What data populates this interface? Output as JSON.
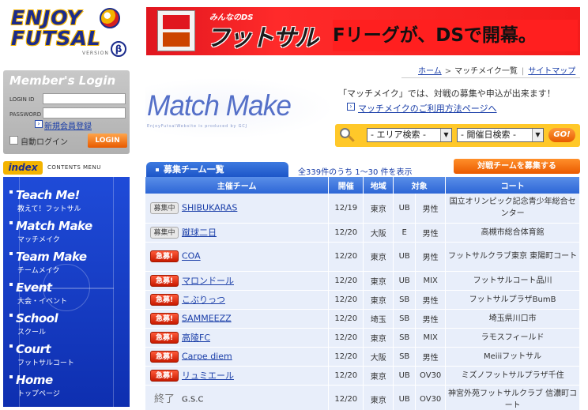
{
  "logo": {
    "line1": "ENJOY",
    "line2": "FUTSAL",
    "version": "VERSION",
    "beta": "β"
  },
  "login": {
    "title": "Member's Login",
    "login_id_label": "LOGIN ID",
    "password_label": "PASSWORD",
    "register_link": "新規会員登録",
    "auto_login_label": "自動ログイン",
    "login_button": "LOGIN"
  },
  "index": {
    "badge": "index",
    "caption": "CONTENTS MENU"
  },
  "nav": [
    {
      "en": "Teach Me!",
      "jp": "教えて！フットサル"
    },
    {
      "en": "Match Make",
      "jp": "マッチメイク"
    },
    {
      "en": "Team Make",
      "jp": "チームメイク"
    },
    {
      "en": "Event",
      "jp": "大会・イベント"
    },
    {
      "en": "School",
      "jp": "スクール"
    },
    {
      "en": "Court",
      "jp": "フットサルコート"
    },
    {
      "en": "Home",
      "jp": "トップページ"
    }
  ],
  "banner": {
    "small": "みんなのDS",
    "big": "フットサル",
    "slogan": "Fリーグが、DSで開幕。"
  },
  "breadcrumb": {
    "home": "ホーム",
    "current": "マッチメイク一覧",
    "sitemap": "サイトマップ"
  },
  "page": {
    "title": "Match Make",
    "subtitle": "EnjoyFutsalWebsite is produced by GCJ",
    "description": "「マッチメイク」では、対戦の募集や申込が出来ます！",
    "guide_link": "マッチメイクのご利用方法ページへ"
  },
  "search": {
    "area_value": "- エリア検索 -",
    "date_value": "- 開催日検索 -",
    "go_label": "GO!"
  },
  "list": {
    "tab_title": "募集チーム一覧",
    "count_text": "全339件のうち 1〜30 件を表示",
    "recruit_button": "対戦チームを募集する",
    "headers": [
      "主催チーム",
      "開催",
      "地域",
      "対象",
      "",
      "コート"
    ],
    "rows": [
      {
        "status": "募集中",
        "status_type": "open",
        "team": "SHIBUKARAS",
        "link": true,
        "date": "12/19",
        "area": "東京",
        "target": "UB",
        "gender": "男性",
        "court": "国立オリンピック記念青少年総合センター"
      },
      {
        "status": "募集中",
        "status_type": "open",
        "team": "蹴球二日",
        "link": true,
        "date": "12/20",
        "area": "大阪",
        "target": "E",
        "gender": "男性",
        "court": "高槻市総合体育館"
      },
      {
        "status": "急募!",
        "status_type": "urgent",
        "team": "COA",
        "link": true,
        "date": "12/20",
        "area": "東京",
        "target": "UB",
        "gender": "男性",
        "court": "フットサルクラブ東京 東陽町コート"
      },
      {
        "status": "急募!",
        "status_type": "urgent",
        "team": "マロンドール",
        "link": true,
        "date": "12/20",
        "area": "東京",
        "target": "UB",
        "gender": "MIX",
        "court": "フットサルコート品川"
      },
      {
        "status": "急募!",
        "status_type": "urgent",
        "team": "こぶりっつ",
        "link": true,
        "date": "12/20",
        "area": "東京",
        "target": "SB",
        "gender": "男性",
        "court": "フットサルプラザBumB"
      },
      {
        "status": "急募!",
        "status_type": "urgent",
        "team": "SAMMEEZZ",
        "link": true,
        "date": "12/20",
        "area": "埼玉",
        "target": "SB",
        "gender": "男性",
        "court": "埼玉県川口市"
      },
      {
        "status": "急募!",
        "status_type": "urgent",
        "team": "高陵FC",
        "link": true,
        "date": "12/20",
        "area": "東京",
        "target": "SB",
        "gender": "MIX",
        "court": "ラモスフィールド"
      },
      {
        "status": "急募!",
        "status_type": "urgent",
        "team": "Carpe diem",
        "link": true,
        "date": "12/20",
        "area": "大阪",
        "target": "SB",
        "gender": "男性",
        "court": "Meiiiフットサル"
      },
      {
        "status": "急募!",
        "status_type": "urgent",
        "team": "リュミエール",
        "link": true,
        "date": "12/20",
        "area": "東京",
        "target": "UB",
        "gender": "OV30",
        "court": "ミズノフットサルプラザ千住"
      },
      {
        "status": "終了",
        "status_type": "closed",
        "team": "G.S.C",
        "link": false,
        "date": "12/20",
        "area": "東京",
        "target": "UB",
        "gender": "OV30",
        "court": "神宮外苑フットサルクラブ 信濃町コート"
      }
    ]
  },
  "colors": {
    "nav_blue": "#1f4bd8",
    "accent_orange": "#ea5a00",
    "banner_red": "#e0161f",
    "search_yellow": "#ffc829"
  }
}
